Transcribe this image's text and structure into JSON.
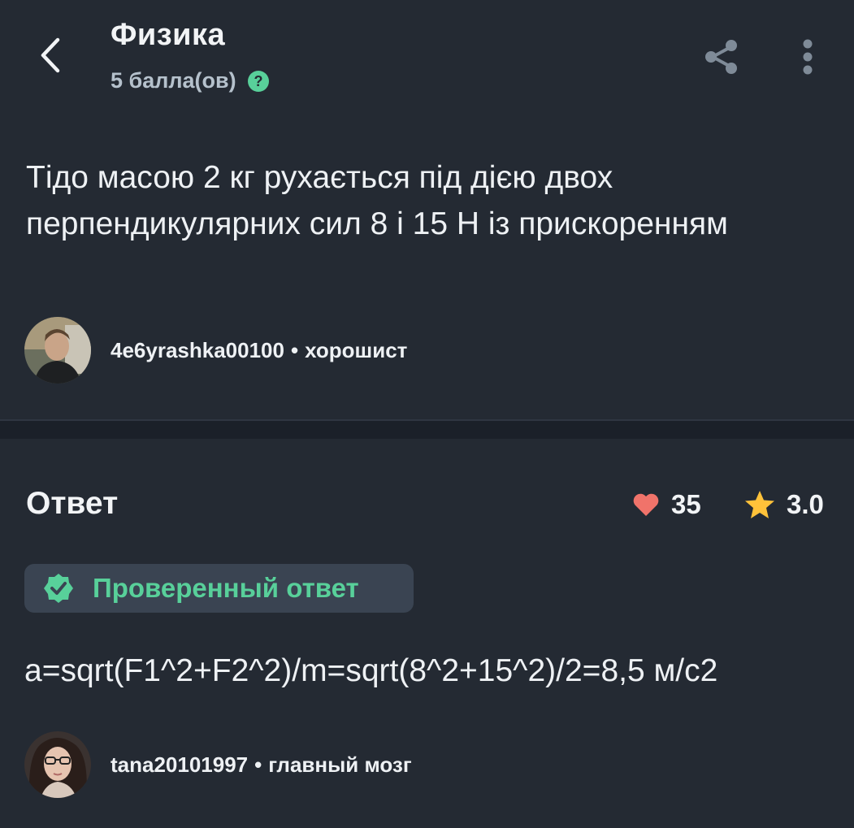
{
  "header": {
    "subject": "Физика",
    "points": "5 балла(ов)",
    "back_icon": "chevron-left-icon",
    "share_icon": "share-icon",
    "more_icon": "more-vertical-icon",
    "help_icon": "help-circle-icon"
  },
  "question": {
    "text": "Тідо масою 2 кг рухається під дією двох перпендикулярних сил 8 і 15 Н із прискоренням",
    "author": {
      "name": "4e6yrashka00100",
      "separator": "•",
      "rank": "хорошист"
    }
  },
  "answer": {
    "title": "Ответ",
    "likes": "35",
    "rating": "3.0",
    "verified_label": "Проверенный ответ",
    "text": "a=sqrt(F1^2+F2^2)/m=sqrt(8^2+15^2)/2=8,5 м/с2",
    "author": {
      "name": "tana20101997",
      "separator": "•",
      "rank": "главный мозг"
    }
  },
  "colors": {
    "background": "#242a33",
    "accent_green": "#58d09a",
    "heart": "#f0736a",
    "star": "#ffc23a",
    "muted_text": "#b5c1cc"
  }
}
